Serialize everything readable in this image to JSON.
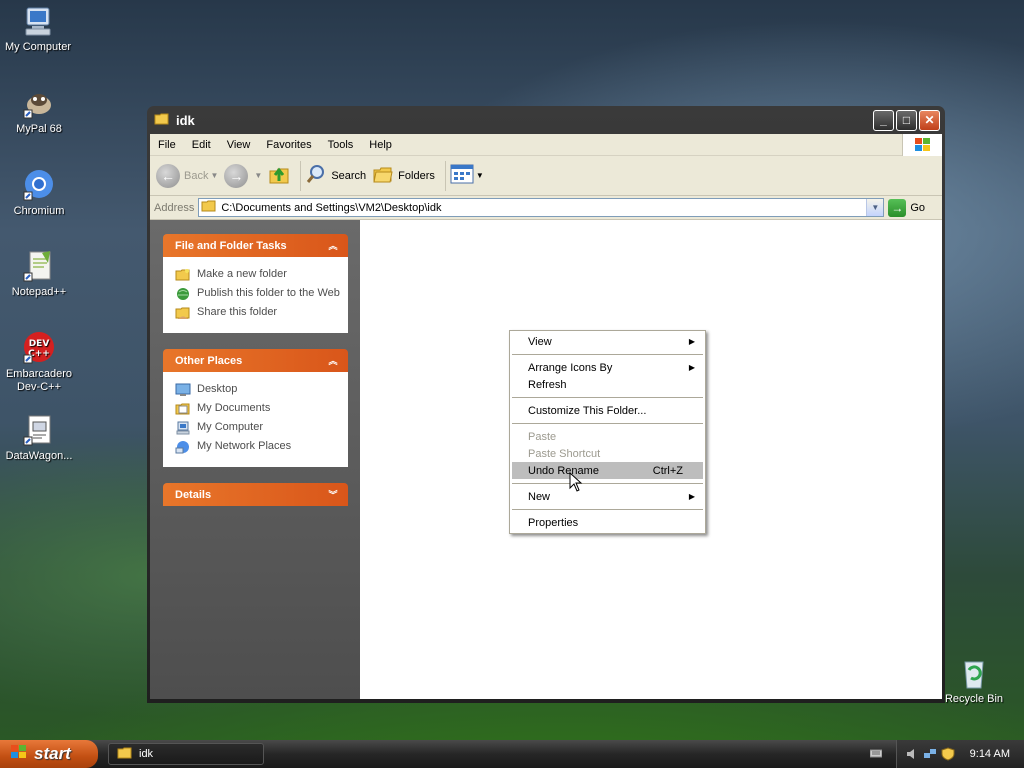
{
  "desktop": {
    "icons": [
      {
        "label": "My Computer"
      },
      {
        "label": "MyPal 68"
      },
      {
        "label": "Chromium"
      },
      {
        "label": "Notepad++"
      },
      {
        "label_line1": "Embarcadero",
        "label_line2": "Dev-C++"
      },
      {
        "label": "DataWagon..."
      },
      {
        "label": "Recycle Bin"
      }
    ],
    "devcpp_badge": "DEV\nC++"
  },
  "window": {
    "title": "idk",
    "menu": [
      "File",
      "Edit",
      "View",
      "Favorites",
      "Tools",
      "Help"
    ],
    "toolbar": {
      "back": "Back",
      "search": "Search",
      "folders": "Folders"
    },
    "address": {
      "label": "Address",
      "value": "C:\\Documents and Settings\\VM2\\Desktop\\idk",
      "go": "Go"
    },
    "taskpane": {
      "file_tasks": {
        "title": "File and Folder Tasks",
        "items": [
          "Make a new folder",
          "Publish this folder to the Web",
          "Share this folder"
        ]
      },
      "other_places": {
        "title": "Other Places",
        "items": [
          "Desktop",
          "My Documents",
          "My Computer",
          "My Network Places"
        ]
      },
      "details": {
        "title": "Details"
      }
    }
  },
  "context_menu": {
    "view": "View",
    "arrange": "Arrange Icons By",
    "refresh": "Refresh",
    "customize": "Customize This Folder...",
    "paste": "Paste",
    "paste_shortcut": "Paste Shortcut",
    "undo": "Undo Rename",
    "undo_shortcut": "Ctrl+Z",
    "new": "New",
    "properties": "Properties"
  },
  "taskbar": {
    "start": "start",
    "task": "idk",
    "clock": "9:14 AM"
  },
  "colors": {
    "accent_orange": "#e8762a",
    "title_dark": "#1f1f1f",
    "menu_bg": "#ece9d8",
    "highlight": "#bdbdbd"
  }
}
